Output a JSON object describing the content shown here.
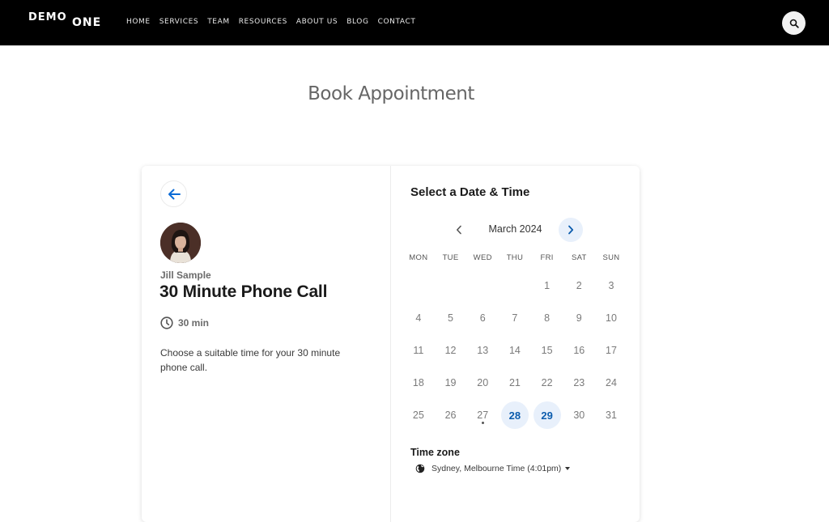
{
  "header": {
    "logo_part1": "DEMO",
    "logo_part2": "ONE",
    "nav": [
      "HOME",
      "SERVICES",
      "TEAM",
      "RESOURCES",
      "ABOUT US",
      "BLOG",
      "CONTACT"
    ],
    "search_icon": "search-icon"
  },
  "page": {
    "title": "Book Appointment"
  },
  "event": {
    "back_icon": "arrow-left-icon",
    "host_name": "Jill Sample",
    "title": "30 Minute Phone Call",
    "duration": "30 min",
    "description": "Choose a suitable time for your 30 minute phone call."
  },
  "scheduler": {
    "title": "Select a Date & Time",
    "month_label": "March 2024",
    "weekdays": [
      "MON",
      "TUE",
      "WED",
      "THU",
      "FRI",
      "SAT",
      "SUN"
    ],
    "leading_blanks": 4,
    "days": [
      {
        "n": "1"
      },
      {
        "n": "2"
      },
      {
        "n": "3"
      },
      {
        "n": "4"
      },
      {
        "n": "5"
      },
      {
        "n": "6"
      },
      {
        "n": "7"
      },
      {
        "n": "8"
      },
      {
        "n": "9"
      },
      {
        "n": "10"
      },
      {
        "n": "11"
      },
      {
        "n": "12"
      },
      {
        "n": "13"
      },
      {
        "n": "14"
      },
      {
        "n": "15"
      },
      {
        "n": "16"
      },
      {
        "n": "17"
      },
      {
        "n": "18"
      },
      {
        "n": "19"
      },
      {
        "n": "20"
      },
      {
        "n": "21"
      },
      {
        "n": "22"
      },
      {
        "n": "23"
      },
      {
        "n": "24"
      },
      {
        "n": "25"
      },
      {
        "n": "26"
      },
      {
        "n": "27",
        "today": true
      },
      {
        "n": "28",
        "available": true
      },
      {
        "n": "29",
        "available": true
      },
      {
        "n": "30"
      },
      {
        "n": "31"
      }
    ],
    "timezone_label": "Time zone",
    "timezone_value": "Sydney, Melbourne Time (4:01pm)"
  },
  "colors": {
    "accent": "#0b5cad",
    "available_bg": "#e8f0fb",
    "header_bg": "#000000"
  }
}
